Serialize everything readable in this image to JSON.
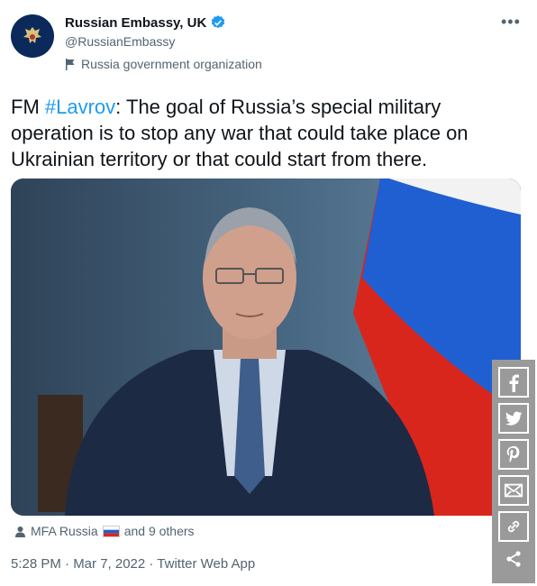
{
  "author": {
    "display_name": "Russian Embassy, UK",
    "handle": "@RussianEmbassy",
    "label": "Russia government organization",
    "verified_icon": "verified-badge-icon",
    "avatar_icon": "coat-of-arms-icon"
  },
  "tweet": {
    "prefix": "FM ",
    "hashtag": "#Lavrov",
    "body": ": The goal of Russia’s special military operation is to stop any war that could take place on Ukrainian territory or that could start from there.",
    "tagged_primary": "MFA Russia",
    "tagged_rest": "and 9 others",
    "timestamp": "5:28 PM · Mar 7, 2022 · Twitter Web App"
  },
  "share_bar": {
    "items": [
      "facebook-icon",
      "twitter-icon",
      "pinterest-icon",
      "email-icon",
      "link-icon",
      "share-icon"
    ]
  },
  "colors": {
    "link": "#1d9bf0",
    "muted": "#536471",
    "share_bar_bg": "#9a9a9a",
    "flag_white": "#ffffff",
    "flag_blue": "#1f5fd1",
    "flag_red": "#d9261c"
  }
}
